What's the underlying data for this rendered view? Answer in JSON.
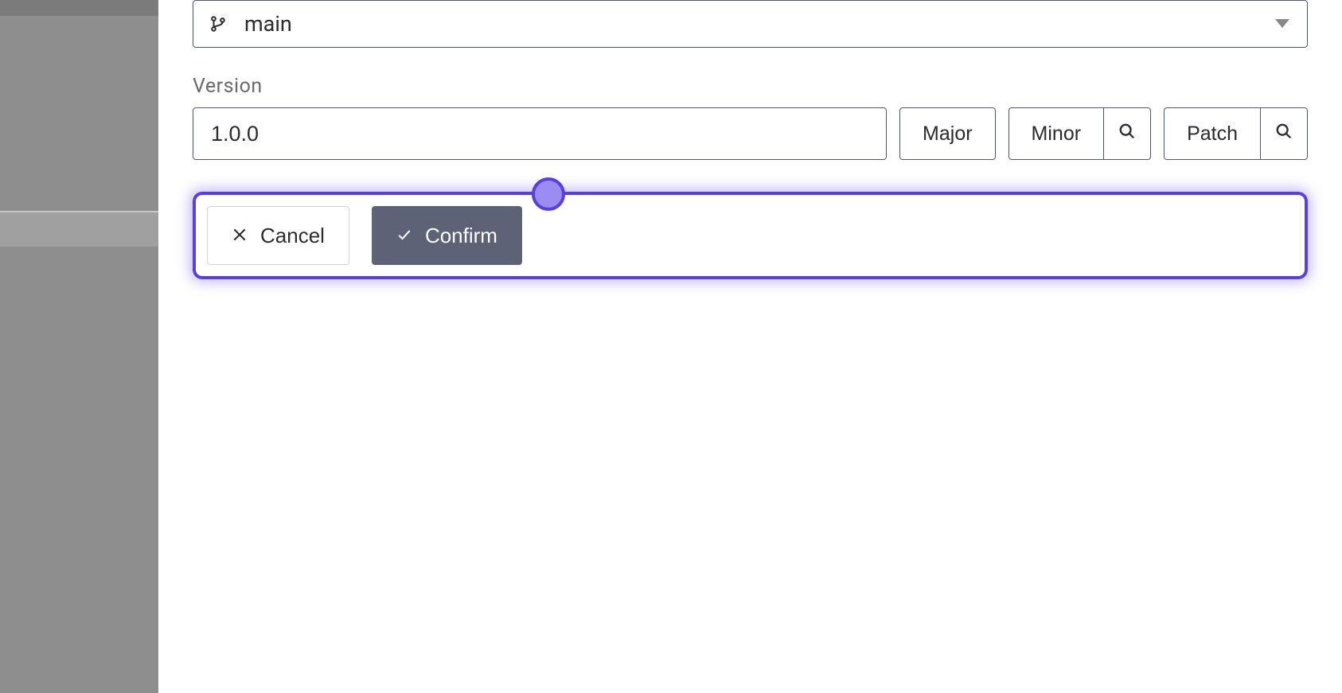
{
  "branch": {
    "selected": "main"
  },
  "version": {
    "label": "Version",
    "value": "1.0.0",
    "buttons": {
      "major": "Major",
      "minor": "Minor",
      "patch": "Patch"
    }
  },
  "actions": {
    "cancel": "Cancel",
    "confirm": "Confirm"
  }
}
